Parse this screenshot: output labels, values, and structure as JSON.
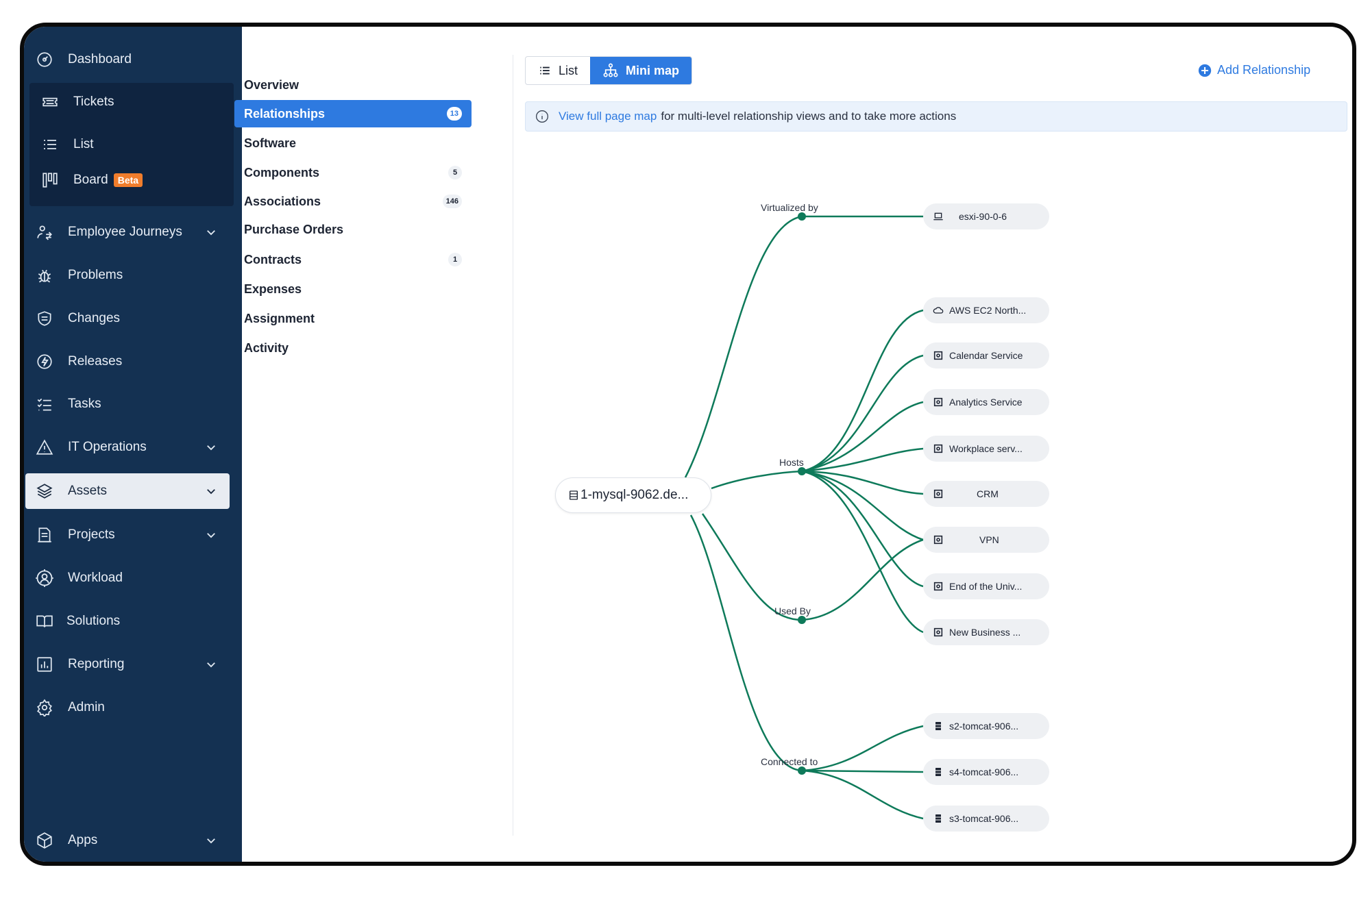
{
  "sidebar": {
    "items": [
      {
        "label": "Dashboard",
        "icon": "dashboard-icon"
      },
      {
        "label": "Tickets",
        "icon": "ticket-icon"
      },
      {
        "label": "List",
        "icon": "list-icon"
      },
      {
        "label": "Board",
        "icon": "board-icon",
        "badge": "Beta"
      },
      {
        "label": "Employee Journeys",
        "icon": "employee-journey-icon"
      },
      {
        "label": "Problems",
        "icon": "bug-icon"
      },
      {
        "label": "Changes",
        "icon": "shield-icon"
      },
      {
        "label": "Releases",
        "icon": "lightning-icon"
      },
      {
        "label": "Tasks",
        "icon": "task-list-icon"
      },
      {
        "label": "IT Operations",
        "icon": "warning-icon"
      },
      {
        "label": "Assets",
        "icon": "layers-icon"
      },
      {
        "label": "Projects",
        "icon": "projects-icon"
      },
      {
        "label": "Workload",
        "icon": "workload-icon"
      },
      {
        "label": "Solutions",
        "icon": "book-icon"
      },
      {
        "label": "Reporting",
        "icon": "chart-icon"
      },
      {
        "label": "Admin",
        "icon": "gear-icon"
      },
      {
        "label": "Apps",
        "icon": "cube-icon"
      }
    ]
  },
  "tabs_nav": {
    "items": [
      {
        "label": "Overview",
        "count": ""
      },
      {
        "label": "Relationships",
        "count": "13"
      },
      {
        "label": "Software",
        "count": ""
      },
      {
        "label": "Components",
        "count": "5"
      },
      {
        "label": "Associations",
        "count": "146"
      },
      {
        "label": "Purchase Orders",
        "count": ""
      },
      {
        "label": "Contracts",
        "count": "1"
      },
      {
        "label": "Expenses",
        "count": ""
      },
      {
        "label": "Assignment",
        "count": ""
      },
      {
        "label": "Activity",
        "count": ""
      }
    ]
  },
  "view_toggle": {
    "list_label": "List",
    "minimap_label": "Mini map"
  },
  "add_relationship_label": "Add Relationship",
  "info": {
    "link_text": "View full page map",
    "text": "for multi-level relationship views and to take more actions"
  },
  "map": {
    "root_label": "1-mysql-9062.de...",
    "relationship_labels": [
      "Virtualized by",
      "Hosts",
      "Used By",
      "Connected to"
    ],
    "nodes": [
      {
        "label": "esxi-90-0-6",
        "icon": "laptop-icon"
      },
      {
        "label": "AWS EC2 North...",
        "icon": "cloud-icon"
      },
      {
        "label": "Calendar Service",
        "icon": "service-icon"
      },
      {
        "label": "Analytics Service",
        "icon": "service-icon"
      },
      {
        "label": "Workplace serv...",
        "icon": "service-icon"
      },
      {
        "label": "CRM",
        "icon": "service-icon"
      },
      {
        "label": "VPN",
        "icon": "service-icon"
      },
      {
        "label": "End of the Univ...",
        "icon": "service-icon"
      },
      {
        "label": "New Business ...",
        "icon": "service-icon"
      },
      {
        "label": "s2-tomcat-906...",
        "icon": "server-icon"
      },
      {
        "label": "s4-tomcat-906...",
        "icon": "server-icon"
      },
      {
        "label": "s3-tomcat-906...",
        "icon": "server-icon"
      }
    ]
  },
  "colors": {
    "sidebar_bg": "#143152",
    "accent": "#2e7ae0",
    "edge": "#0e7a5a",
    "beta": "#f07d2c"
  }
}
